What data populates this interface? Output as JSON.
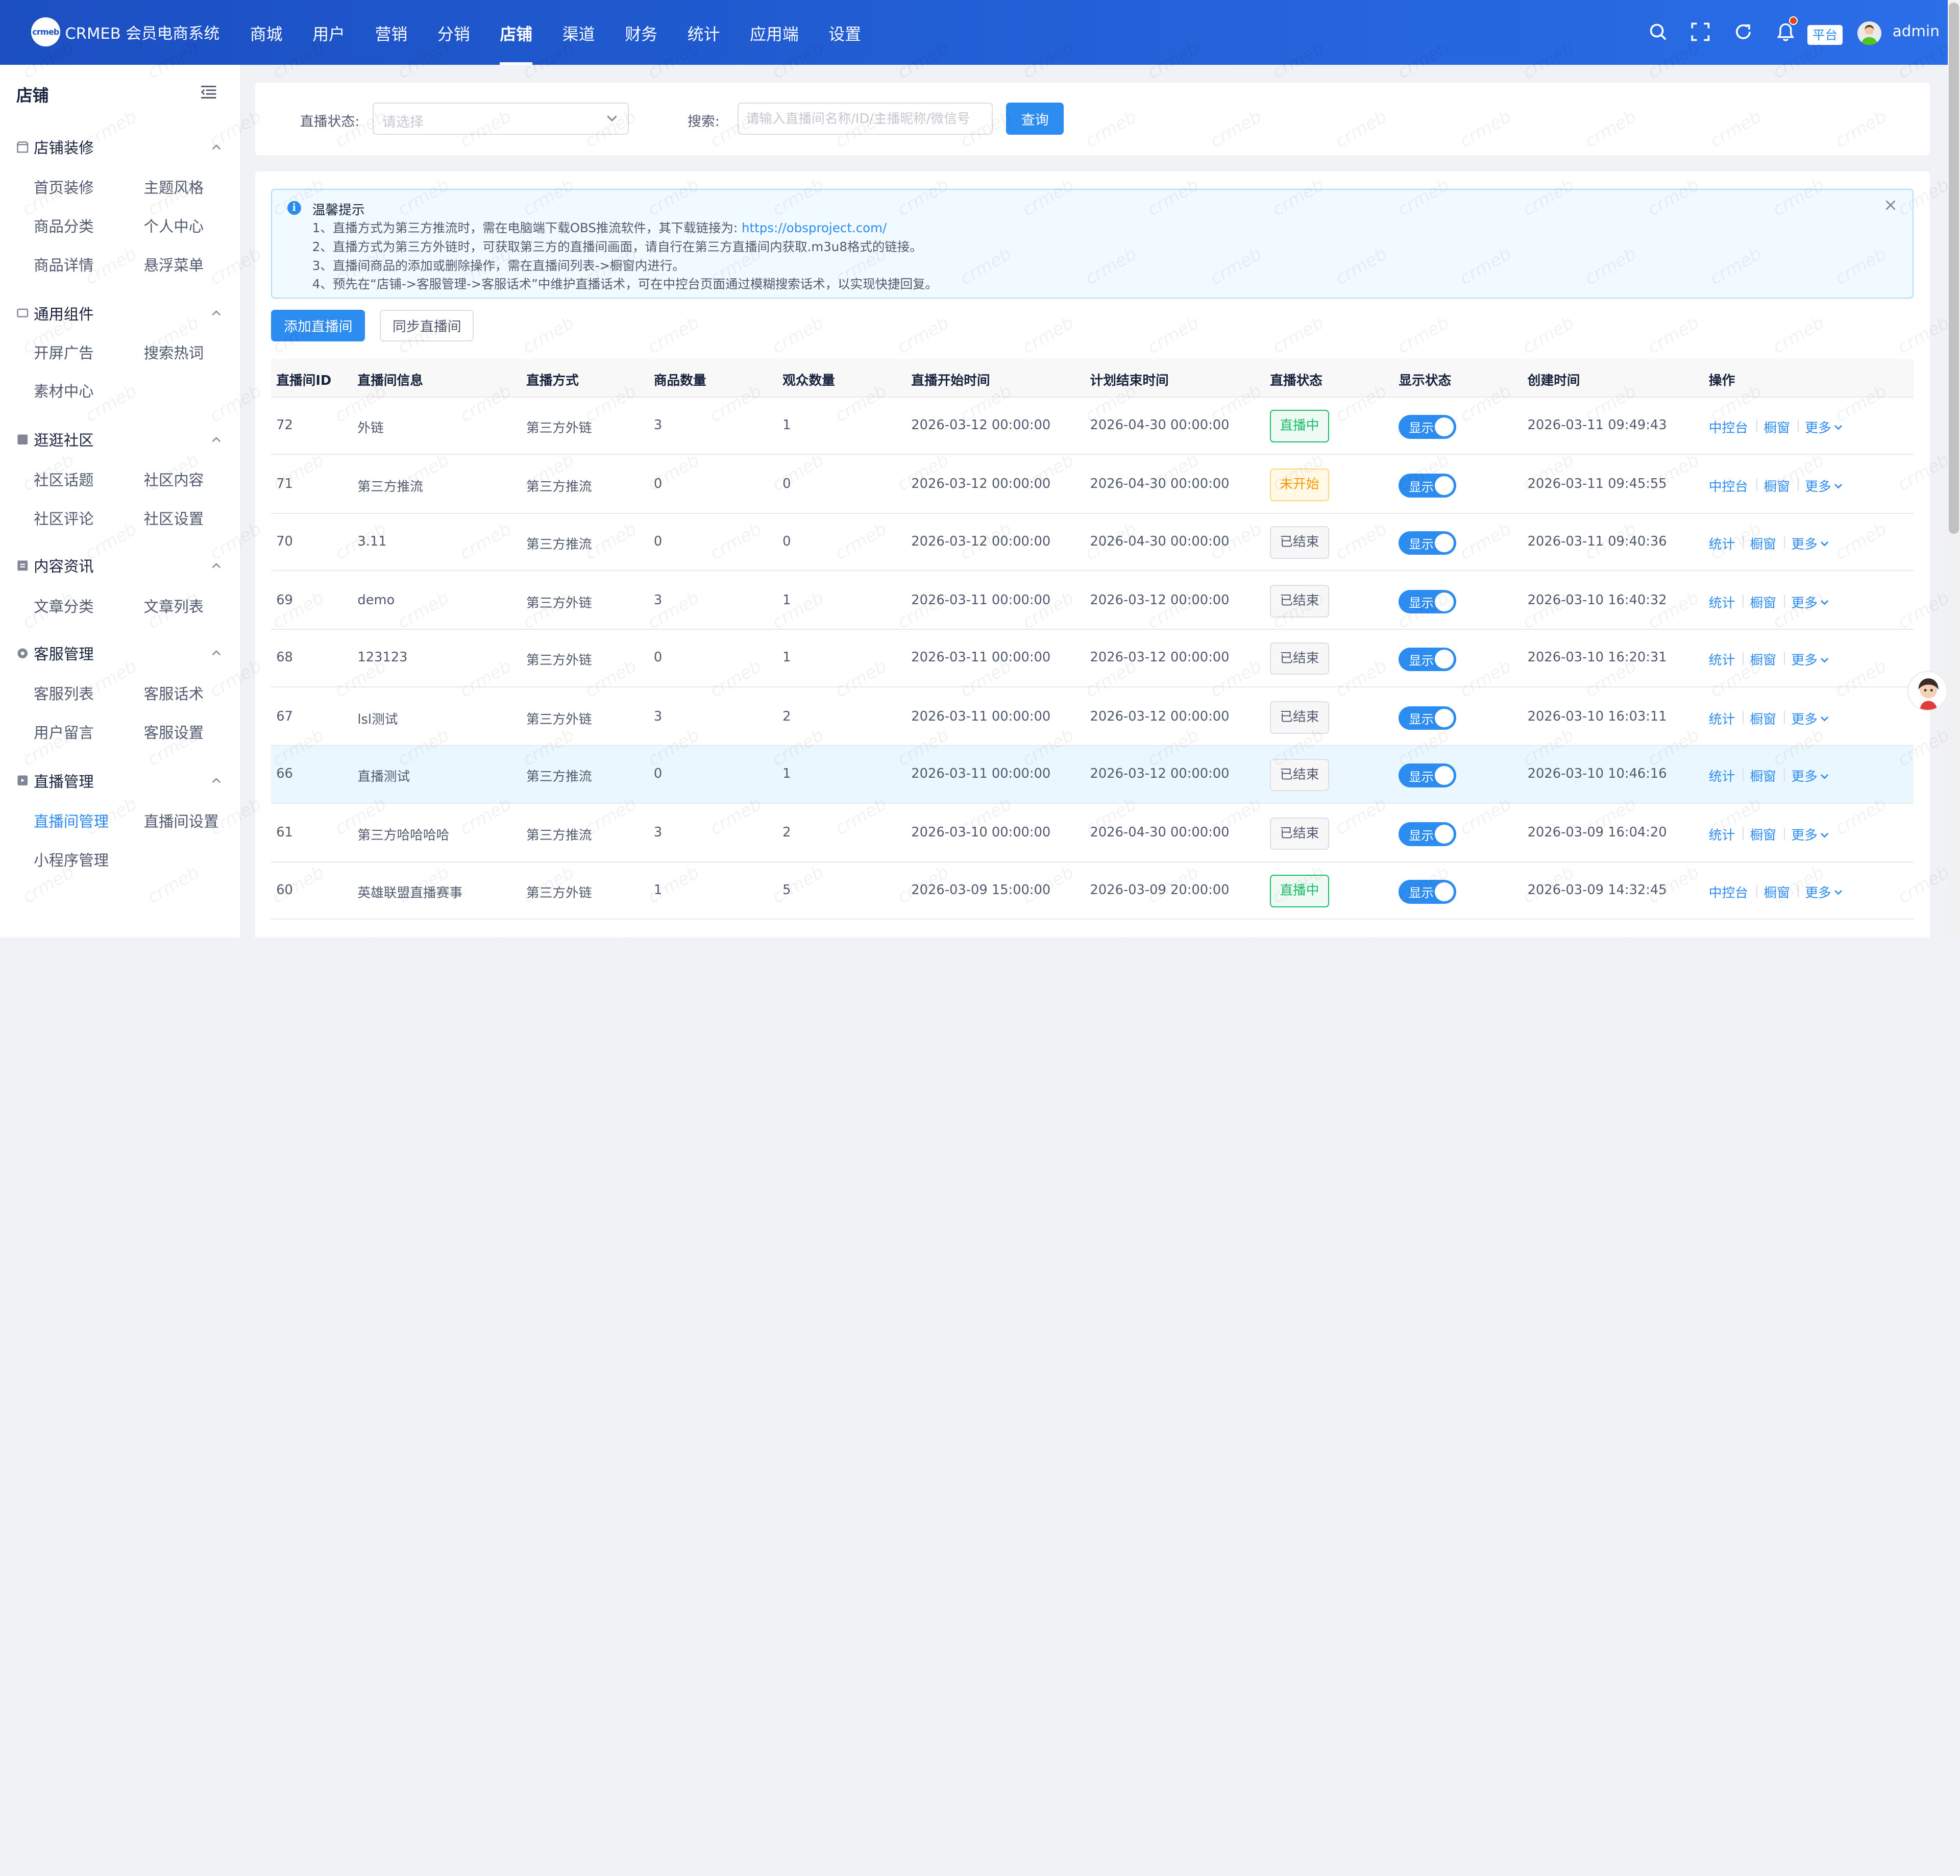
{
  "app": {
    "logo_mark": "crmeb",
    "title": "CRMEB 会员电商系统"
  },
  "nav": [
    "商城",
    "用户",
    "营销",
    "分销",
    "店铺",
    "渠道",
    "财务",
    "统计",
    "应用端",
    "设置"
  ],
  "nav_active": "店铺",
  "header": {
    "platform_badge": "平台",
    "username": "admin",
    "icons": [
      "search-icon",
      "fullscreen-icon",
      "refresh-icon",
      "bell-icon"
    ]
  },
  "sidebar": {
    "title": "店铺",
    "groups": [
      {
        "label": "店铺装修",
        "icon": "shop-icon",
        "items": [
          "首页装修",
          "主题风格",
          "商品分类",
          "个人中心",
          "商品详情",
          "悬浮菜单"
        ]
      },
      {
        "label": "通用组件",
        "icon": "component-icon",
        "items": [
          "开屏广告",
          "搜索热词",
          "素材中心"
        ]
      },
      {
        "label": "逛逛社区",
        "icon": "community-icon",
        "items": [
          "社区话题",
          "社区内容",
          "社区评论",
          "社区设置"
        ]
      },
      {
        "label": "内容资讯",
        "icon": "article-icon",
        "items": [
          "文章分类",
          "文章列表"
        ]
      },
      {
        "label": "客服管理",
        "icon": "service-icon",
        "items": [
          "客服列表",
          "客服话术",
          "用户留言",
          "客服设置"
        ]
      },
      {
        "label": "直播管理",
        "icon": "live-icon",
        "items": [
          "直播间管理",
          "直播间设置",
          "小程序管理"
        ]
      }
    ],
    "active_item": "直播间管理"
  },
  "filter": {
    "status_label": "直播状态:",
    "status_placeholder": "请选择",
    "search_label": "搜索:",
    "search_placeholder": "请输入直播间名称/ID/主播昵称/微信号",
    "query_button": "查询"
  },
  "notice": {
    "title": "温馨提示",
    "line1_prefix": "1、直播方式为第三方推流时，需在电脑端下载OBS推流软件，其下载链接为: ",
    "line1_link": "https://obsproject.com/",
    "line2": "2、直播方式为第三方外链时，可获取第三方的直播间画面，请自行在第三方直播间内获取.m3u8格式的链接。",
    "line3": "3、直播间商品的添加或删除操作，需在直播间列表->橱窗内进行。",
    "line4": "4、预先在“店铺->客服管理->客服话术”中维护直播话术，可在中控台页面通过模糊搜索话术，以实现快捷回复。"
  },
  "buttons": {
    "add": "添加直播间",
    "sync": "同步直播间"
  },
  "table": {
    "columns": [
      "直播间ID",
      "直播间信息",
      "直播方式",
      "商品数量",
      "观众数量",
      "直播开始时间",
      "计划结束时间",
      "直播状态",
      "显示状态",
      "创建时间",
      "操作"
    ],
    "show_label": "显示",
    "more_label": "更多",
    "rows": [
      {
        "id": "72",
        "info": "外链",
        "mode": "第三方外链",
        "goods": "3",
        "viewers": "1",
        "start": "2026-03-12 00:00:00",
        "end": "2026-04-30 00:00:00",
        "status": "直播中",
        "status_type": "live",
        "created": "2026-03-11 09:49:43",
        "actions": [
          "中控台",
          "橱窗"
        ]
      },
      {
        "id": "71",
        "info": "第三方推流",
        "mode": "第三方推流",
        "goods": "0",
        "viewers": "0",
        "start": "2026-03-12 00:00:00",
        "end": "2026-04-30 00:00:00",
        "status": "未开始",
        "status_type": "pending",
        "created": "2026-03-11 09:45:55",
        "actions": [
          "中控台",
          "橱窗"
        ]
      },
      {
        "id": "70",
        "info": "3.11",
        "mode": "第三方推流",
        "goods": "0",
        "viewers": "0",
        "start": "2026-03-12 00:00:00",
        "end": "2026-04-30 00:00:00",
        "status": "已结束",
        "status_type": "ended",
        "created": "2026-03-11 09:40:36",
        "actions": [
          "统计",
          "橱窗"
        ]
      },
      {
        "id": "69",
        "info": "demo",
        "mode": "第三方外链",
        "goods": "3",
        "viewers": "1",
        "start": "2026-03-11 00:00:00",
        "end": "2026-03-12 00:00:00",
        "status": "已结束",
        "status_type": "ended",
        "created": "2026-03-10 16:40:32",
        "actions": [
          "统计",
          "橱窗"
        ]
      },
      {
        "id": "68",
        "info": "123123",
        "mode": "第三方外链",
        "goods": "0",
        "viewers": "1",
        "start": "2026-03-11 00:00:00",
        "end": "2026-03-12 00:00:00",
        "status": "已结束",
        "status_type": "ended",
        "created": "2026-03-10 16:20:31",
        "actions": [
          "统计",
          "橱窗"
        ]
      },
      {
        "id": "67",
        "info": "lsl测试",
        "mode": "第三方外链",
        "goods": "3",
        "viewers": "2",
        "start": "2026-03-11 00:00:00",
        "end": "2026-03-12 00:00:00",
        "status": "已结束",
        "status_type": "ended",
        "created": "2026-03-10 16:03:11",
        "actions": [
          "统计",
          "橱窗"
        ]
      },
      {
        "id": "66",
        "info": "直播测试",
        "mode": "第三方推流",
        "goods": "0",
        "viewers": "1",
        "start": "2026-03-11 00:00:00",
        "end": "2026-03-12 00:00:00",
        "status": "已结束",
        "status_type": "ended",
        "created": "2026-03-10 10:46:16",
        "actions": [
          "统计",
          "橱窗"
        ],
        "highlight": true
      },
      {
        "id": "61",
        "info": "第三方哈哈哈哈",
        "mode": "第三方推流",
        "goods": "3",
        "viewers": "2",
        "start": "2026-03-10 00:00:00",
        "end": "2026-04-30 00:00:00",
        "status": "已结束",
        "status_type": "ended",
        "created": "2026-03-09 16:04:20",
        "actions": [
          "统计",
          "橱窗"
        ]
      },
      {
        "id": "60",
        "info": "英雄联盟直播赛事",
        "mode": "第三方外链",
        "goods": "1",
        "viewers": "5",
        "start": "2026-03-09 15:00:00",
        "end": "2026-03-09 20:00:00",
        "status": "直播中",
        "status_type": "live",
        "created": "2026-03-09 14:32:45",
        "actions": [
          "中控台",
          "橱窗"
        ]
      }
    ]
  },
  "colors": {
    "primary": "#2d8cf0",
    "live_text": "#19be6b",
    "live_bg": "#f0faf5",
    "pending_text": "#ff9900",
    "pending_bg": "#fff9e6",
    "ended_text": "#515a6e",
    "ended_bg": "#f7f7f7"
  },
  "watermark": "crmeb"
}
